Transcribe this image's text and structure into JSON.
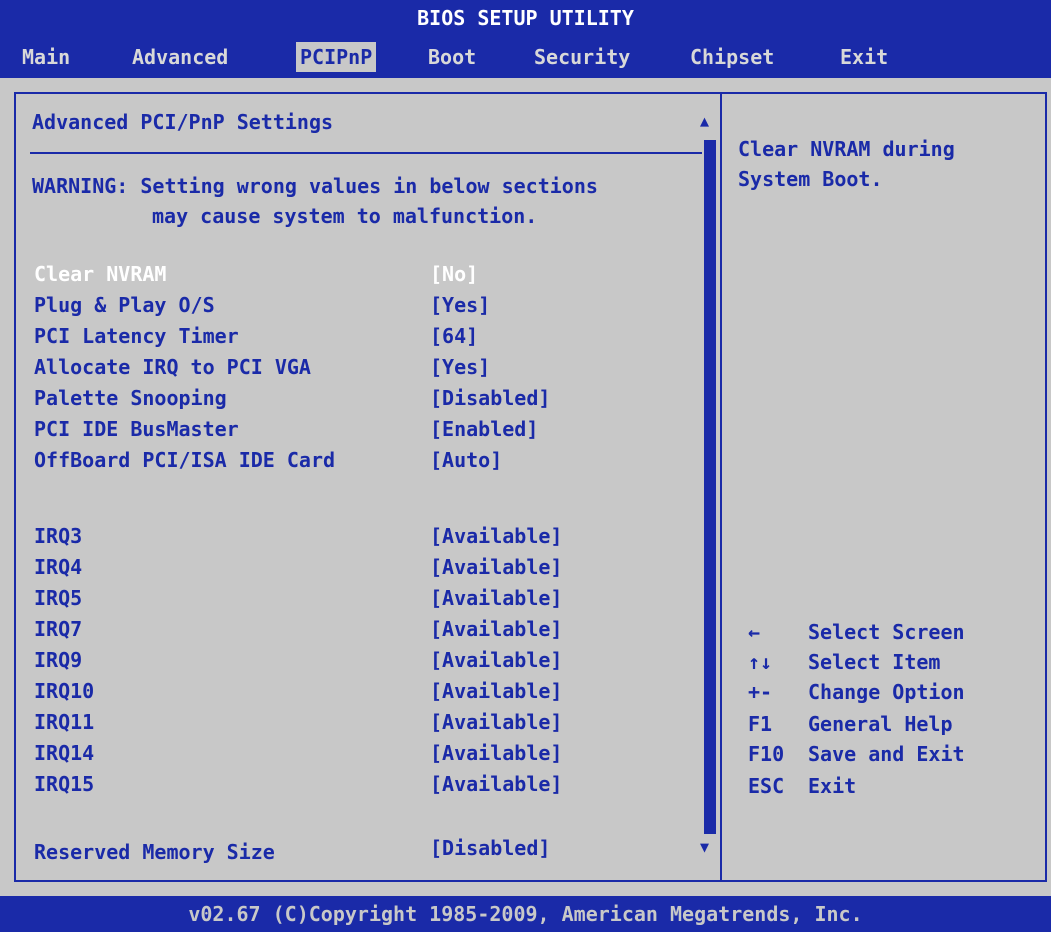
{
  "title": "BIOS SETUP UTILITY",
  "menu": [
    "Main",
    "Advanced",
    "PCIPnP",
    "Boot",
    "Security",
    "Chipset",
    "Exit"
  ],
  "section_title": "Advanced PCI/PnP Settings",
  "warning": [
    "WARNING: Setting wrong values in below sections",
    "may cause system to malfunction."
  ],
  "settings": [
    {
      "label": "Clear NVRAM",
      "value": "[No]"
    },
    {
      "label": "Plug & Play O/S",
      "value": "[Yes]"
    },
    {
      "label": "PCI Latency Timer",
      "value": "[64]"
    },
    {
      "label": "Allocate IRQ to PCI VGA",
      "value": "[Yes]"
    },
    {
      "label": "Palette Snooping",
      "value": "[Disabled]"
    },
    {
      "label": "PCI IDE BusMaster",
      "value": "[Enabled]"
    },
    {
      "label": "OffBoard PCI/ISA IDE Card",
      "value": "[Auto]"
    }
  ],
  "irqs": [
    {
      "label": "IRQ3",
      "value": "[Available]"
    },
    {
      "label": "IRQ4",
      "value": "[Available]"
    },
    {
      "label": "IRQ5",
      "value": "[Available]"
    },
    {
      "label": "IRQ7",
      "value": "[Available]"
    },
    {
      "label": "IRQ9",
      "value": "[Available]"
    },
    {
      "label": "IRQ10",
      "value": "[Available]"
    },
    {
      "label": "IRQ11",
      "value": "[Available]"
    },
    {
      "label": "IRQ14",
      "value": "[Available]"
    },
    {
      "label": "IRQ15",
      "value": "[Available]"
    }
  ],
  "reserved": {
    "label": "Reserved Memory Size",
    "value": "[Disabled]"
  },
  "help": "Clear NVRAM during System Boot.",
  "keys": [
    {
      "key": "←",
      "desc": "Select Screen"
    },
    {
      "key": "↑↓",
      "desc": " Select Item"
    },
    {
      "key": "+-",
      "desc": " Change Option"
    },
    {
      "key": "F1",
      "desc": " General Help"
    },
    {
      "key": "F10",
      "desc": " Save and Exit"
    },
    {
      "key": "ESC",
      "desc": "Exit"
    }
  ],
  "footer": "v02.67 (C)Copyright 1985-2009, American Megatrends, Inc.",
  "colors": {
    "bios_blue": "#1a2aa8",
    "background": "#c8c8c8",
    "selected_text": "#ffffff"
  }
}
